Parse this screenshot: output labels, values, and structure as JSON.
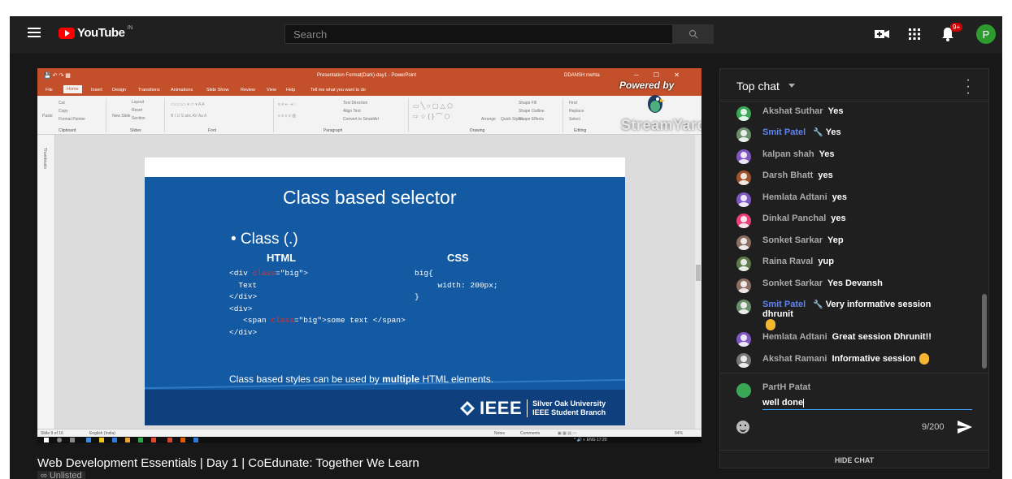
{
  "header": {
    "logo_text": "YouTube",
    "country_code": "IN",
    "search_placeholder": "Search",
    "notif_count": "9+",
    "avatar_letter": "P"
  },
  "powerpoint": {
    "window_title": "Presentation Format(Dark)-day1 - PowerPoint",
    "user_name": "DDANSH mehta",
    "tabs": [
      "File",
      "Home",
      "Insert",
      "Design",
      "Transitions",
      "Animations",
      "Slide Show",
      "Review",
      "View",
      "Help",
      "Tell me what you want to do"
    ],
    "groups": [
      "Clipboard",
      "Slides",
      "Font",
      "Paragraph",
      "Drawing",
      "Editing"
    ],
    "ribbon_items": {
      "paste": "Paste",
      "cut": "Cut",
      "copy": "Copy",
      "format_painter": "Format Painter",
      "new_slide": "New Slide",
      "layout": "Layout",
      "reset": "Reset",
      "section": "Section",
      "text_direction": "Text Direction",
      "align_text": "Align Text",
      "convert_smartart": "Convert to SmartArt",
      "arrange": "Arrange",
      "quick_styles": "Quick Styles",
      "shape_fill": "Shape Fill",
      "shape_outline": "Shape Outline",
      "shape_effects": "Shape Effects",
      "find": "Find",
      "replace": "Replace",
      "select": "Select"
    },
    "thumbnails_label": "Thumbnails",
    "status_slide": "Slide 9 of 16",
    "status_lang": "English (India)",
    "status_notes": "Notes",
    "status_comments": "Comments",
    "status_zoom": "84%",
    "tray_lang": "ENG",
    "tray_time": "17:20"
  },
  "overlay": {
    "powered_by": "Powered by",
    "streamyard": "StreamYard"
  },
  "slide": {
    "title": "Class based     selector",
    "bullet": "• Class (.)",
    "html_heading": "HTML",
    "css_heading": "CSS",
    "html_code": {
      "line1_a": "<div ",
      "line1_kw": "class",
      "line1_b": "=\"big\">",
      "line2": "  Text",
      "line3": "</div>",
      "line4": "<div>",
      "line5_a": "   <span ",
      "line5_kw": "class",
      "line5_b": "=\"big\">some text </span>",
      "line6": "</div>"
    },
    "css_code": {
      "line1": "big{",
      "line2": "     width: 200px;",
      "line3": "}"
    },
    "note_a": "Class based styles can be used by ",
    "note_b": "multiple",
    "note_c": " HTML elements.",
    "ieee": "IEEE",
    "ieee_sub1": "Silver Oak University",
    "ieee_sub2": "IEEE Student Branch"
  },
  "video_info": {
    "title": "Web Development Essentials | Day 1 | CoEdunate: Together We Learn",
    "visibility": "Unlisted"
  },
  "chat": {
    "header": "Top chat",
    "messages": [
      {
        "author": "Akshat Suthar",
        "text": "Yes",
        "mod": false,
        "color": "#3aa757"
      },
      {
        "author": "Smit Patel",
        "text": "Yes",
        "mod": true,
        "color": "#6b8e6b"
      },
      {
        "author": "kalpan shah",
        "text": "Yes",
        "mod": false,
        "color": "#7e57c2"
      },
      {
        "author": "Darsh Bhatt",
        "text": "yes",
        "mod": false,
        "color": "#a0522d"
      },
      {
        "author": "Hemlata Adtani",
        "text": "yes",
        "mod": false,
        "color": "#7e57c2"
      },
      {
        "author": "Dinkal Panchal",
        "text": "yes",
        "mod": false,
        "color": "#ec407a"
      },
      {
        "author": "Sonket Sarkar",
        "text": "Yep",
        "mod": false,
        "color": "#8d6e63"
      },
      {
        "author": "Raina Raval",
        "text": "yup",
        "mod": false,
        "color": "#5d7a4a"
      },
      {
        "author": "Sonket Sarkar",
        "text": "Yes Devansh",
        "mod": false,
        "color": "#8d6e63"
      },
      {
        "author": "Smit Patel",
        "text": "Very informative session dhrunit",
        "mod": true,
        "color": "#6b8e6b"
      },
      {
        "author": "Hemlata Adtani",
        "text": "Great session Dhrunit!!",
        "mod": false,
        "color": "#7e57c2"
      },
      {
        "author": "Akshat Ramani",
        "text": "Informative session",
        "mod": false,
        "color": "#777777"
      }
    ],
    "composer_name": "PartH Patat",
    "composer_value": "well done",
    "char_count": "9/200",
    "hide_chat": "HIDE CHAT"
  }
}
